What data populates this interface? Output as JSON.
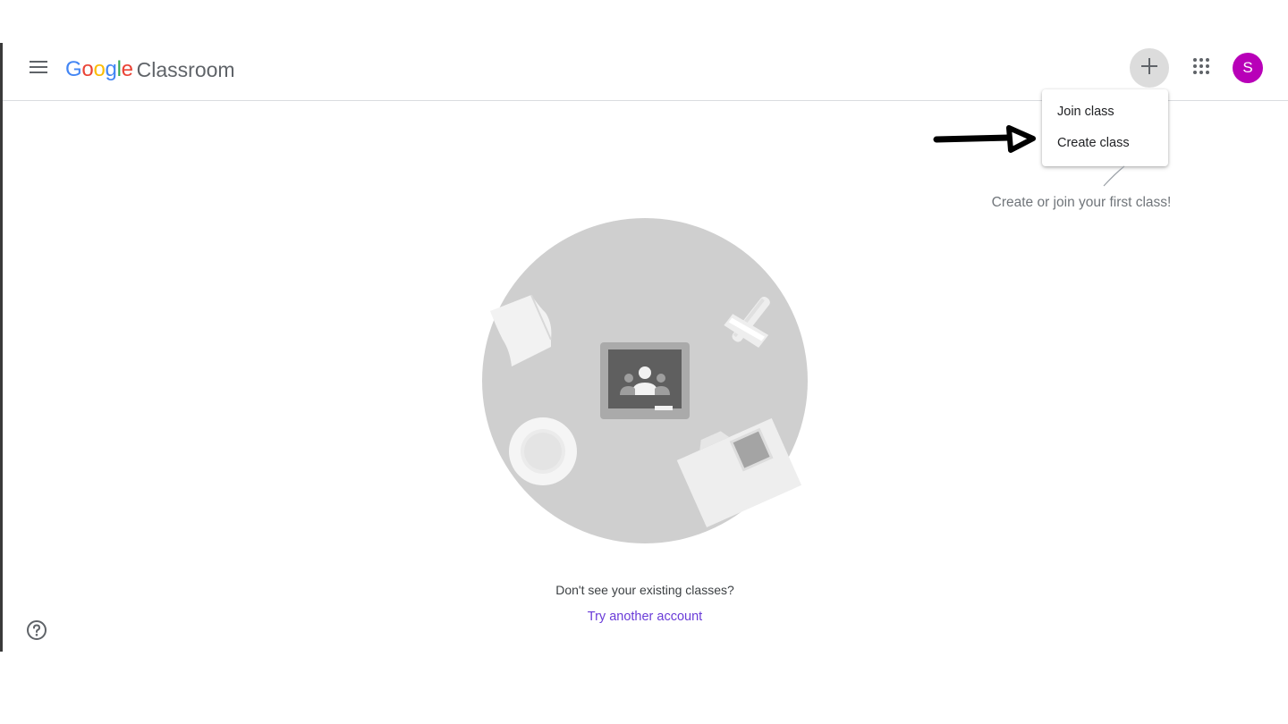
{
  "header": {
    "logo_letters": [
      "G",
      "o",
      "o",
      "g",
      "l",
      "e"
    ],
    "logo_colors": [
      "#4285F4",
      "#EA4335",
      "#FBBC05",
      "#4285F4",
      "#34A853",
      "#EA4335"
    ],
    "product_name": "Classroom",
    "avatar_initial": "S",
    "avatar_color": "#b800b8"
  },
  "icons": {
    "menu": "hamburger-menu-icon",
    "add": "plus-icon",
    "apps": "apps-grid-icon",
    "help": "help-circle-icon"
  },
  "add_menu": {
    "items": [
      {
        "label": "Join class"
      },
      {
        "label": "Create class"
      }
    ]
  },
  "empty_state": {
    "hint": "Create or join your first class!",
    "question": "Don't see your existing classes?",
    "link": "Try another account"
  }
}
